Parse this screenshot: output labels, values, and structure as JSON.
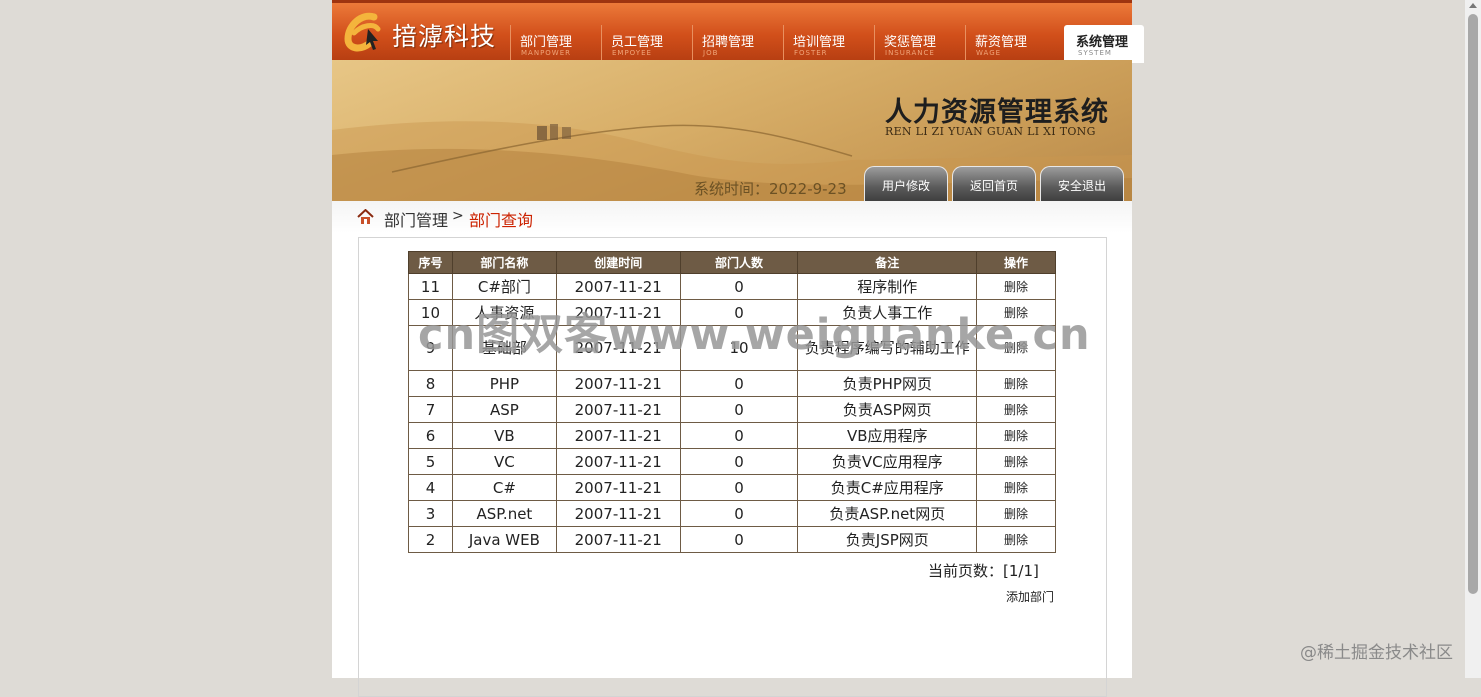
{
  "brand": {
    "logo_letter": "e",
    "name": "揞滹科技"
  },
  "nav": [
    {
      "label": "部门管理",
      "sub": "MANPOWER",
      "active": false
    },
    {
      "label": "员工管理",
      "sub": "EMPOYEE",
      "active": false
    },
    {
      "label": "招聘管理",
      "sub": "JOB",
      "active": false
    },
    {
      "label": "培训管理",
      "sub": "FOSTER",
      "active": false
    },
    {
      "label": "奖惩管理",
      "sub": "INSURANCE",
      "active": false
    },
    {
      "label": "薪资管理",
      "sub": "WAGE",
      "active": false
    },
    {
      "label": "系统管理",
      "sub": "SYSTEM",
      "active": true
    }
  ],
  "banner": {
    "title": "人力资源管理系统",
    "subtitle": "REN LI ZI YUAN GUAN LI XI TONG",
    "sys_time_label": "系统时间：",
    "sys_time_value": "2022-9-23",
    "buttons": [
      "用户修改",
      "返回首页",
      "安全退出"
    ]
  },
  "breadcrumb": {
    "section": "部门管理",
    "separator": ">",
    "current": "部门查询"
  },
  "table": {
    "headers": [
      "序号",
      "部门名称",
      "创建时间",
      "部门人数",
      "备注",
      "操作"
    ],
    "rows": [
      {
        "id": "11",
        "name": "C#部门",
        "created": "2007-11-21",
        "count": "0",
        "note": "程序制作",
        "action": "删除"
      },
      {
        "id": "10",
        "name": "人事资源",
        "created": "2007-11-21",
        "count": "0",
        "note": "负责人事工作",
        "action": "删除"
      },
      {
        "id": "9",
        "name": "基础部",
        "created": "2007-11-21",
        "count": "10",
        "note": "负责程序编写的辅助工作",
        "action": "删除"
      },
      {
        "id": "8",
        "name": "PHP",
        "created": "2007-11-21",
        "count": "0",
        "note": "负责PHP网页",
        "action": "删除"
      },
      {
        "id": "7",
        "name": "ASP",
        "created": "2007-11-21",
        "count": "0",
        "note": "负责ASP网页",
        "action": "删除"
      },
      {
        "id": "6",
        "name": "VB",
        "created": "2007-11-21",
        "count": "0",
        "note": "VB应用程序",
        "action": "删除"
      },
      {
        "id": "5",
        "name": "VC",
        "created": "2007-11-21",
        "count": "0",
        "note": "负责VC应用程序",
        "action": "删除"
      },
      {
        "id": "4",
        "name": "C#",
        "created": "2007-11-21",
        "count": "0",
        "note": "负责C#应用程序",
        "action": "删除"
      },
      {
        "id": "3",
        "name": "ASP.net",
        "created": "2007-11-21",
        "count": "0",
        "note": "负责ASP.net网页",
        "action": "删除"
      },
      {
        "id": "2",
        "name": "Java WEB",
        "created": "2007-11-21",
        "count": "0",
        "note": "负责JSP网页",
        "action": "删除"
      }
    ]
  },
  "pager": {
    "label": "当前页数：",
    "value": "[1/1]"
  },
  "add_link": "添加部门",
  "watermarks": {
    "center": "cn图双客www.weiguanke.cn",
    "corner": "@稀土掘金技术社区"
  },
  "colors": {
    "header_orange": "#d2501b",
    "table_header": "#6e5b45",
    "crumb_current": "#cc2200"
  }
}
